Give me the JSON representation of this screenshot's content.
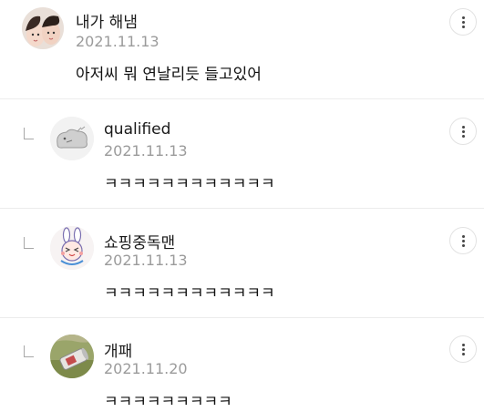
{
  "comments": [
    {
      "author": "내가 해냄",
      "date": "2021.11.13",
      "text": "아저씨 뭐 연날리듯 들고있어",
      "avatar_icon": "profile-photo-girls"
    },
    {
      "author": "qualified",
      "date": "2021.11.13",
      "text": "ㅋㅋㅋㅋㅋㅋㅋㅋㅋㅋㅋㅋ",
      "avatar_icon": "gray-blob-character"
    },
    {
      "author": "쇼핑중독맨",
      "date": "2021.11.13",
      "text": "ㅋㅋㅋㅋㅋㅋㅋㅋㅋㅋㅋㅋ",
      "avatar_icon": "rabbit-character"
    },
    {
      "author": "개패",
      "date": "2021.11.20",
      "text": "ㅋㅋㅋㅋㅋㅋㅋㅋㅋ",
      "avatar_icon": "can-on-ground-photo"
    }
  ],
  "icons": {
    "more": "more-vertical-icon",
    "reply": "reply-arrow-icon"
  }
}
